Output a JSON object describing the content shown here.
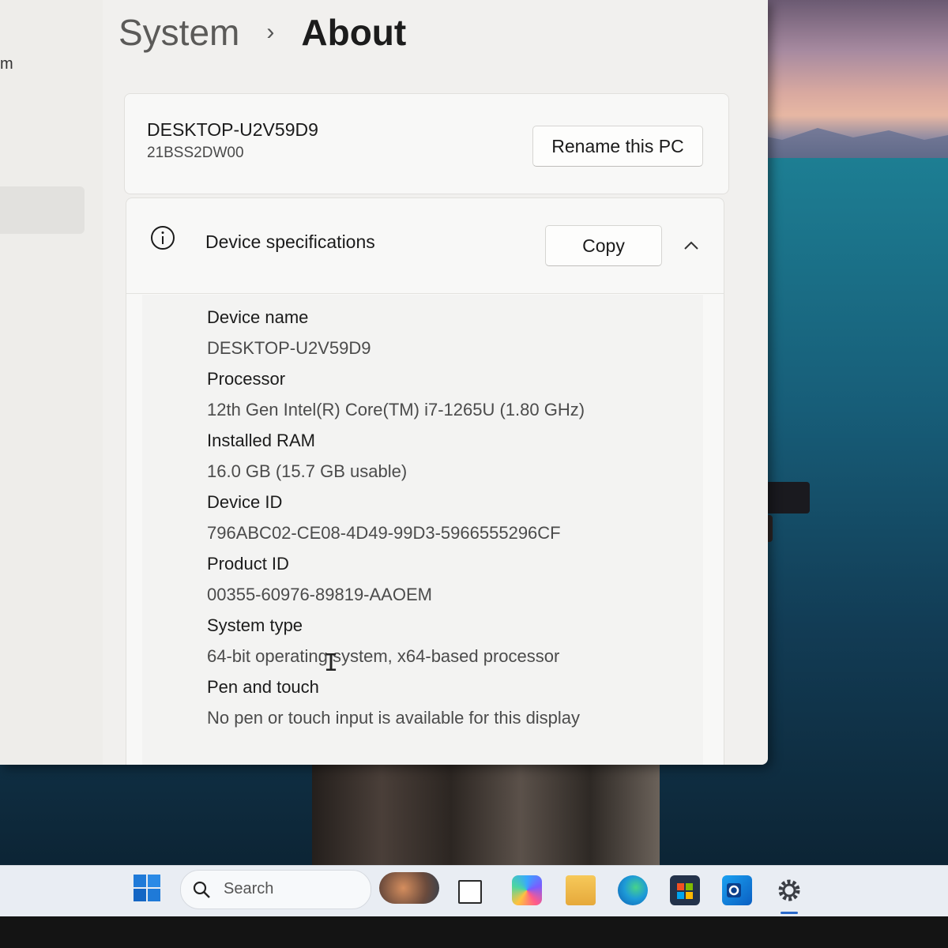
{
  "window": {
    "nav_fragment": "m",
    "breadcrumb": {
      "parent": "System",
      "separator": "›",
      "current": "About"
    }
  },
  "pc_card": {
    "device_name": "DESKTOP-U2V59D9",
    "model": "21BSS2DW00",
    "rename_label": "Rename this PC"
  },
  "specs": {
    "title": "Device specifications",
    "copy_label": "Copy",
    "items": [
      {
        "label": "Device name",
        "value": "DESKTOP-U2V59D9"
      },
      {
        "label": "Processor",
        "value": "12th Gen Intel(R) Core(TM) i7-1265U (1.80 GHz)"
      },
      {
        "label": "Installed RAM",
        "value": "16.0 GB (15.7 GB usable)"
      },
      {
        "label": "Device ID",
        "value": "796ABC02-CE08-4D49-99D3-5966555296CF"
      },
      {
        "label": "Product ID",
        "value": "00355-60976-89819-AAOEM"
      },
      {
        "label": "System type",
        "value": "64-bit operating system, x64-based processor"
      },
      {
        "label": "Pen and touch",
        "value": "No pen or touch input is available for this display"
      }
    ]
  },
  "taskbar": {
    "search_placeholder": "Search",
    "icons": [
      "windows-start-icon",
      "search-icon",
      "widgets-icon",
      "task-view-icon",
      "copilot-icon",
      "file-explorer-icon",
      "edge-icon",
      "microsoft-store-icon",
      "outlook-icon",
      "settings-icon"
    ]
  },
  "colors": {
    "accent": "#2a68c9",
    "window_bg": "#f1f0ee",
    "card_bg": "#f8f8f7"
  }
}
